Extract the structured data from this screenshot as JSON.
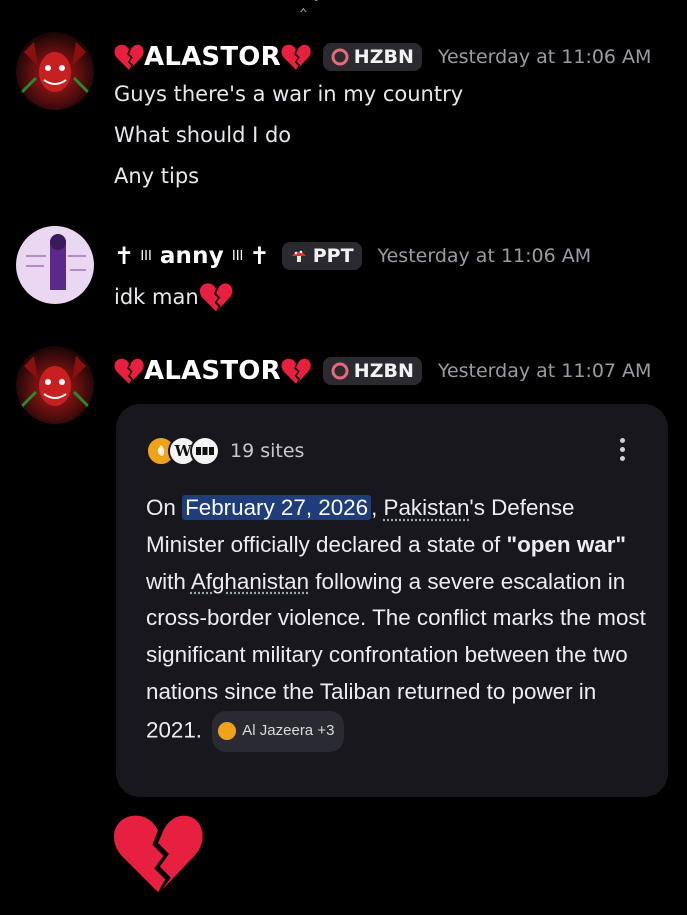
{
  "messages": [
    {
      "username": "ALASTOR",
      "tag": "HZBN",
      "timestamp": "Yesterday at 11:06 AM",
      "lines": [
        "Guys there's a war in my country",
        "What should I do",
        "Any tips"
      ]
    },
    {
      "username_prefix": "✝",
      "username_bars": "III",
      "username": "anny",
      "username_suffix": "✝",
      "tag": "PPT",
      "timestamp": "Yesterday at 11:06 AM",
      "lines": [
        "idk man"
      ]
    },
    {
      "username": "ALASTOR",
      "tag": "HZBN",
      "timestamp": "Yesterday at 11:07 AM",
      "card": {
        "sources_label": "19 sites",
        "wiki_glyph": "W",
        "text": {
          "p1": "On ",
          "date": "February 27, 2026",
          "p2": ", ",
          "country1": "Pakistan",
          "p3": "'s Defense Minister officially declared a state of ",
          "bold": "\"open war\"",
          "p4": " with ",
          "country2": "Afghanistan",
          "p5": " following a severe escalation in cross-border violence. The conflict marks the most significant military confrontation between the two nations since the Taliban returned to power in 2021.",
          "cite": "Al Jazeera +3"
        }
      }
    }
  ],
  "icons": {
    "broken_heart_color": "#e8203f",
    "tag_hzbn_icon": "hazbin-badge-icon",
    "tag_ppt_icon": "mushroom-icon"
  }
}
